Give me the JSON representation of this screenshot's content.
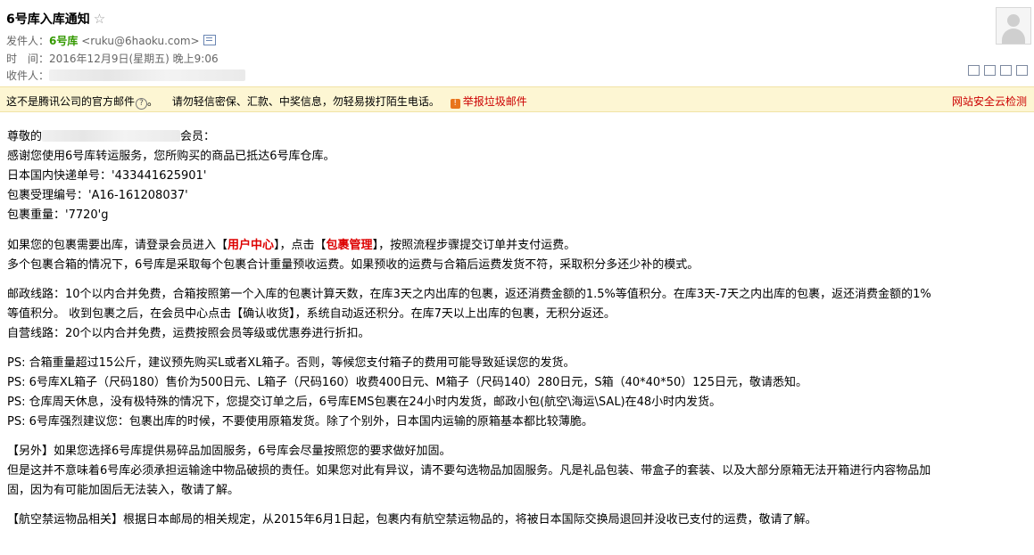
{
  "header": {
    "subject": "6号库入库通知",
    "star": "☆",
    "from_label": "发件人：",
    "from_name": "6号库",
    "from_addr": "<ruku@6haoku.com>",
    "time_label": "时　间：",
    "time_value": "2016年12月9日(星期五) 晚上9:06",
    "to_label": "收件人："
  },
  "warning": {
    "notice": "这不是腾讯公司的官方邮件",
    "question": "?",
    "notice_end": "。",
    "tip": "请勿轻信密保、汇款、中奖信息，勿轻易拨打陌生电话。",
    "report": "举报垃圾邮件",
    "right": "网站安全云检测",
    "accent": "#cc0000"
  },
  "body": {
    "greet_pre": "尊敬的",
    "greet_post": "会员：",
    "l2": "感谢您使用6号库转运服务，您所购买的商品已抵达6号库仓库。",
    "l3": "日本国内快递单号：'433441625901'",
    "l4": "包裹受理编号：'A16-161208037'",
    "l5": "包裹重量：'7720'g",
    "p2a_1": "如果您的包裹需要出库，请登录会员进入【",
    "p2a_link1": "用户中心",
    "p2a_2": "】，点击【",
    "p2a_link2": "包裹管理",
    "p2a_3": "】，按照流程步骤提交订单并支付运费。",
    "p2b": "多个包裹合箱的情况下，6号库是采取每个包裹合计重量预收运费。如果预收的运费与合箱后运费发货不符，采取积分多还少补的模式。",
    "p3a": "邮政线路：10个以内合并免费，合箱按照第一个入库的包裹计算天数，在库3天之内出库的包裹，返还消费金额的1.5%等值积分。在库3天-7天之内出库的包裹，返还消费金额的1%",
    "p3b": "等值积分。 收到包裹之后，在会员中心点击【确认收货】，系统自动返还积分。在库7天以上出库的包裹，无积分返还。",
    "p3c": "自营线路：20个以内合并免费，运费按照会员等级或优惠券进行折扣。",
    "ps1": "PS: 合箱重量超过15公斤，建议预先购买L或者XL箱子。否则，等候您支付箱子的费用可能导致延误您的发货。",
    "ps2": "PS: 6号库XL箱子（尺码180）售价为500日元、L箱子（尺码160）收费400日元、M箱子（尺码140）280日元，S箱（40*40*50）125日元，敬请悉知。",
    "ps3": "PS: 仓库周天休息，没有极特殊的情况下，您提交订单之后，6号库EMS包裹在24小时内发货，邮政小包(航空\\海运\\SAL)在48小时内发货。",
    "ps4": "PS: 6号库强烈建议您：包裹出库的时候，不要使用原箱发货。除了个别外，日本国内运输的原箱基本都比较薄脆。",
    "o1": "【另外】如果您选择6号库提供易碎品加固服务，6号库会尽量按照您的要求做好加固。",
    "o2": "但是这并不意味着6号库必须承担运输途中物品破损的责任。如果您对此有异议，请不要勾选物品加固服务。凡是礼品包装、带盒子的套装、以及大部分原箱无法开箱进行内容物品加",
    "o3": "固，因为有可能加固后无法装入，敬请了解。",
    "a1": "【航空禁运物品相关】根据日本邮局的相关规定，从2015年6月1日起，包裹内有航空禁运物品的，将被日本国际交换局退回并没收已支付的运费，敬请了解。"
  }
}
